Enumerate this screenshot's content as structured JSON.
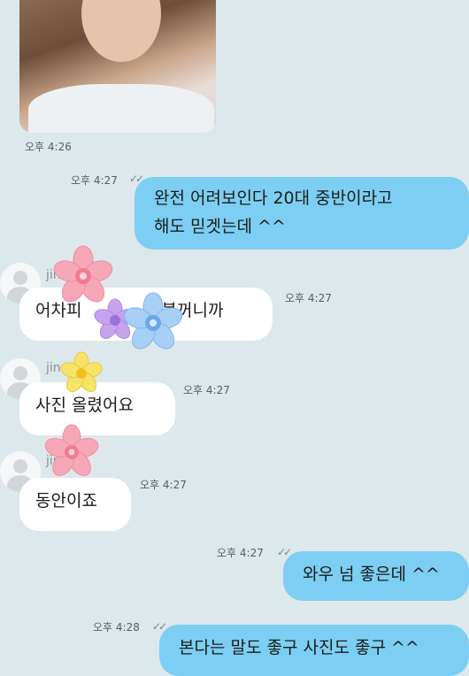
{
  "messages": [
    {
      "type": "photo",
      "time": "오후 4:26"
    },
    {
      "type": "out",
      "time": "오후 4:27",
      "lines": [
        "완전 어려보인다 20대 중반이라고",
        "해도 믿겟는데 ^^"
      ]
    },
    {
      "type": "in",
      "sender": "jin",
      "time": "오후 4:27",
      "text": "어차피 ........... 볼꺼니까"
    },
    {
      "type": "in",
      "sender": "jin...",
      "time": "오후 4:27",
      "text": "사진 올렸어요"
    },
    {
      "type": "in",
      "sender": "jin",
      "time": "오후 4:27",
      "text": "동안이죠"
    },
    {
      "type": "out",
      "time": "오후 4:27",
      "text": "와우 넘 좋은데 ^^"
    },
    {
      "type": "out",
      "time": "오후 4:28",
      "text": "본다는 말도 좋구 사진도 좋구 ^^"
    }
  ],
  "m2": {
    "text": "어차피",
    "text_end": "볼꺼니까",
    "name": "jin"
  },
  "m3": {
    "name": "jin...d"
  },
  "m4": {
    "name": "jin...1"
  },
  "icons": {
    "read_receipt": "double-check-icon",
    "avatar": "default-profile-icon",
    "sticker": "flower-sticker-icon"
  },
  "colors": {
    "outgoing": "#7ccff2",
    "incoming": "#ffffff",
    "background": "#dde8ec"
  }
}
